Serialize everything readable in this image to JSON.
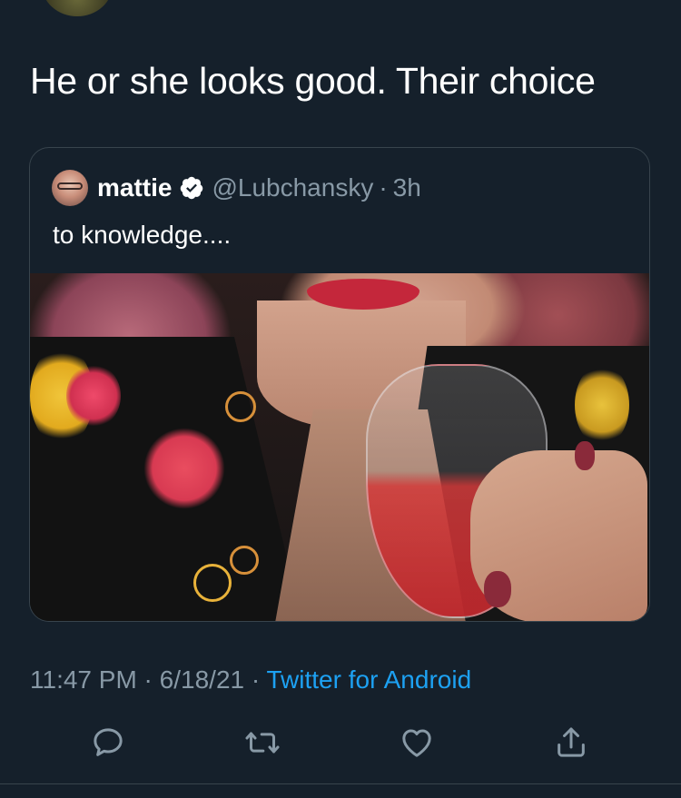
{
  "tweet": {
    "text": "He or she looks good. Their choice"
  },
  "quoted_tweet": {
    "name": "mattie",
    "verified_icon": "verified-badge-icon",
    "handle": "@Lubchansky",
    "separator": "·",
    "time": "3h",
    "text": "to knowledge....",
    "media": "photo of person with red lipstick in embroidered floral jacket holding a glass of rosé"
  },
  "meta": {
    "time": "11:47 PM",
    "sep1": " · ",
    "date": "6/18/21",
    "sep2": " · ",
    "source": "Twitter for Android"
  },
  "actions": [
    {
      "name": "reply",
      "icon": "reply-icon"
    },
    {
      "name": "retweet",
      "icon": "retweet-icon"
    },
    {
      "name": "like",
      "icon": "heart-icon"
    },
    {
      "name": "share",
      "icon": "share-icon"
    }
  ],
  "colors": {
    "background": "#15202b",
    "text": "#ffffff",
    "secondary_text": "#8899a6",
    "accent": "#1da1f2",
    "border": "#38444d"
  }
}
